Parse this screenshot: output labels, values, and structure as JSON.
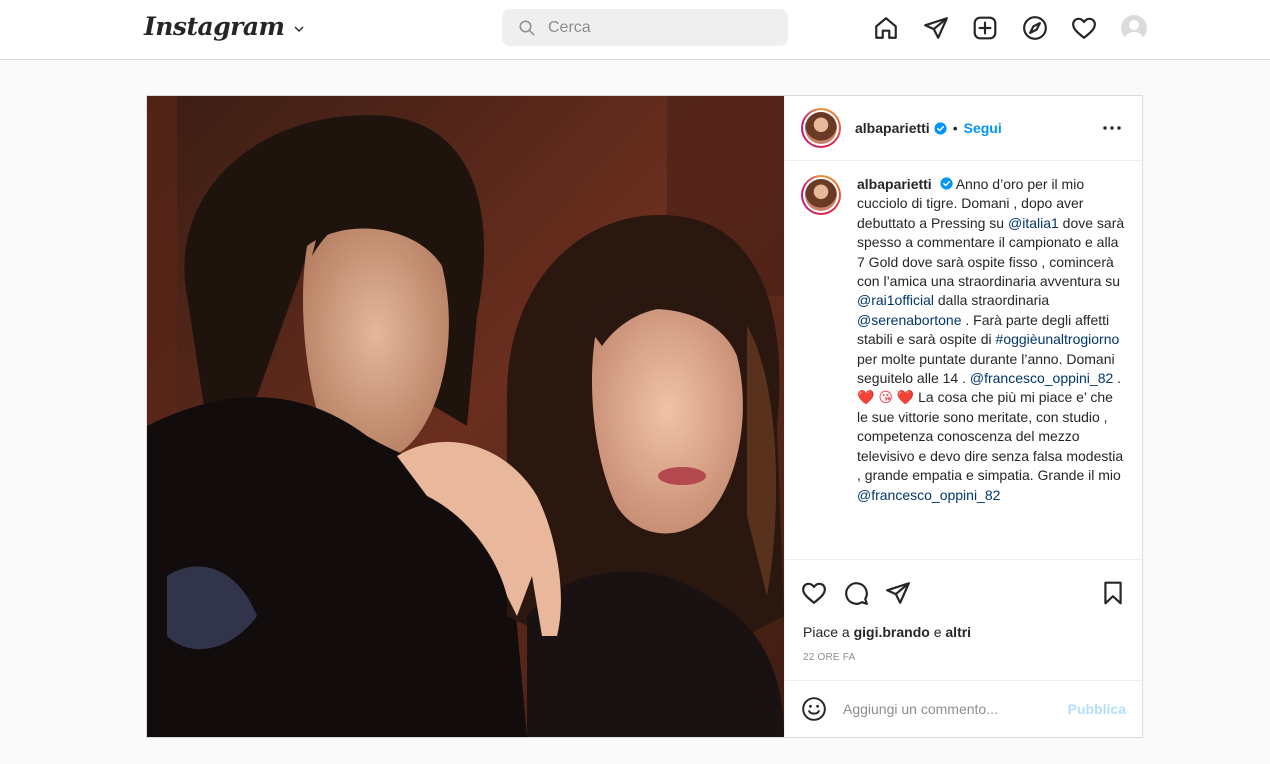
{
  "header": {
    "logo": "Instagram",
    "search_placeholder": "Cerca",
    "nav_icons": [
      "home-icon",
      "direct-icon",
      "new-post-icon",
      "explore-icon",
      "activity-icon",
      "profile-avatar"
    ]
  },
  "post": {
    "username": "albaparietti",
    "follow_dot": "•",
    "follow_label": "Segui",
    "caption": {
      "username": "albaparietti",
      "segments": [
        " Anno d’oro per il mio cucciolo di tigre. Domani , dopo aver debuttato a Pressing su ",
        "@italia1",
        " dove sarà spesso a commentare il campionato e alla 7 Gold dove sarà ospite fisso , comincerà con l’amica una straordinaria avventura su ",
        "@rai1official",
        " dalla straordinaria ",
        "@serenabortone",
        " . Farà parte degli affetti stabili e sarà ospite di ",
        "#oggièunaltrogiorno",
        " per molte puntate durante l’anno. Domani seguitelo alle 14 . ",
        "@francesco_oppini_82",
        " . ",
        "❤️ 😘 ❤️",
        " La cosa che più mi piace e’ che le sue vittorie sono meritate, con studio , competenza conoscenza del mezzo televisivo e devo dire senza falsa modestia , grande empatia e simpatia. Grande il mio ",
        "@francesco_oppini_82"
      ]
    },
    "likes": {
      "prefix": "Piace a ",
      "user": "gigi.brando",
      "middle": " e ",
      "others": "altri"
    },
    "time": "22 ORE FA",
    "comment_placeholder": "Aggiungi un commento...",
    "publish_label": "Pubblica"
  },
  "colors": {
    "accent": "#0095f6",
    "link": "#00376b",
    "publish_disabled": "#b2dffc",
    "heart": "#ed4956"
  }
}
